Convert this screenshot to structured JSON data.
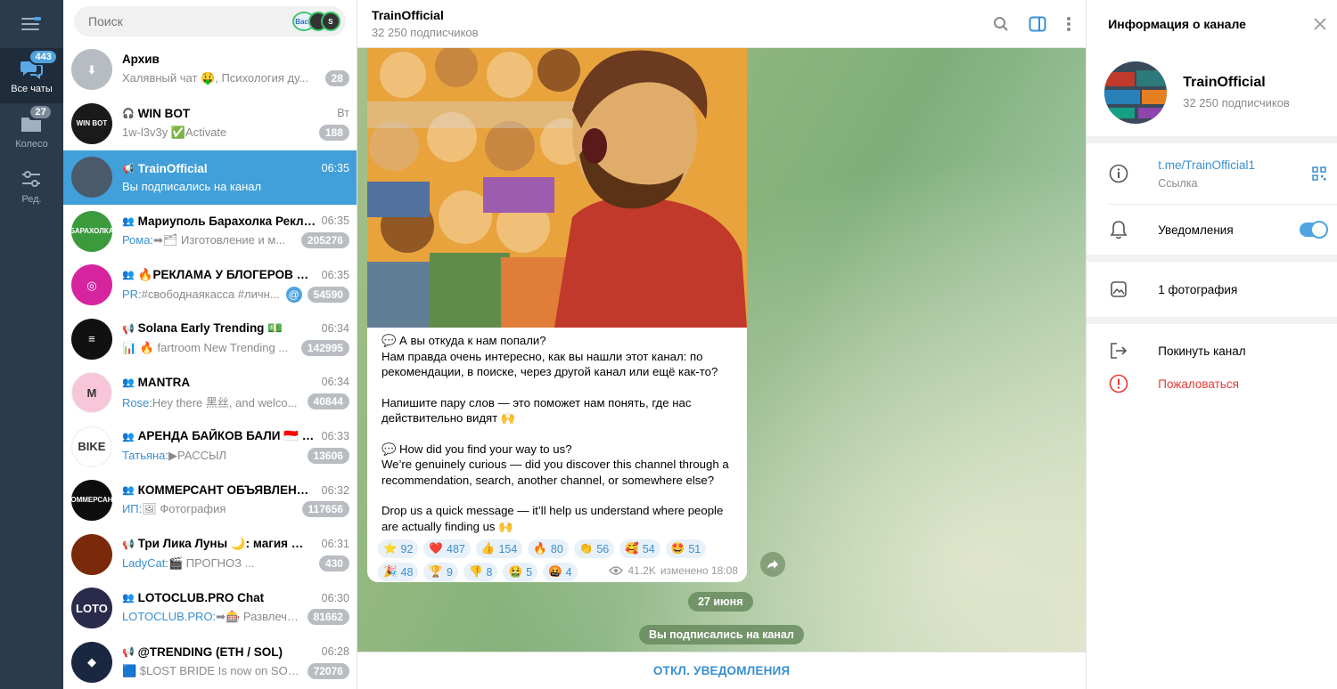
{
  "rail": {
    "folders": [
      {
        "label": "Все чаты",
        "badge": "443"
      },
      {
        "label": "Колесо",
        "badge": "27"
      },
      {
        "label": "Ред.",
        "badge": ""
      }
    ]
  },
  "search": {
    "placeholder": "Поиск",
    "story1": "Вася",
    "story2": "S"
  },
  "chats": [
    {
      "title": "Архив",
      "time": "",
      "sender": "",
      "preview": "Халявный чат 🤑, Психология ду...",
      "badge": "28",
      "avatar_text": "⬇",
      "avatar_color": "#b7bcc2"
    },
    {
      "title": "WIN BOT",
      "time": "Вт",
      "sender": "",
      "preview": "1w-l3v3y ✅Activate",
      "badge": "188",
      "avatar_text": "WIN BOT",
      "avatar_color": "#1a1a1a"
    },
    {
      "title": "TrainOfficial",
      "time": "06:35",
      "sender": "",
      "preview": "Вы подписались на канал",
      "badge": "",
      "avatar_text": "",
      "avatar_color": "#4a5a6a"
    },
    {
      "title": "Мариуполь Барахолка Рекла...",
      "time": "06:35",
      "sender": "Рома:",
      "preview": "➡🗂 Изготовление и м...",
      "badge": "205276",
      "avatar_text": "БАРАХОЛКА",
      "avatar_color": "#3b9a3b"
    },
    {
      "title": "🔥РЕКЛАМА У БЛОГЕРОВ 🔥...",
      "time": "06:35",
      "sender": "PR:",
      "preview": "#свободнаякасса #личн...",
      "badge": "54590",
      "avatar_text": "◎",
      "avatar_color": "#d6249f"
    },
    {
      "title": "Solana Early Trending 💵",
      "time": "06:34",
      "sender": "",
      "preview": "📊 🔥 fartroom New Trending ...",
      "badge": "142995",
      "avatar_text": "≡",
      "avatar_color": "#111111"
    },
    {
      "title": "MANTRA",
      "time": "06:34",
      "sender": "Rose:",
      "preview": "Hey there 黑丝, and welco...",
      "badge": "40844",
      "avatar_text": "M",
      "avatar_color": "#f7c6d9"
    },
    {
      "title": "АРЕНДА БАЙКОВ БАЛИ 🇮🇩 BI...",
      "time": "06:33",
      "sender": "Татьяна:",
      "preview": "▶РАССЫЛ",
      "badge": "13606",
      "avatar_text": "BIKE",
      "avatar_color": "#ffffff"
    },
    {
      "title": "КОММЕРСАНТ ОБЪЯВЛЕНИЯ ...",
      "time": "06:32",
      "sender": "ИП:",
      "preview": "🖼 Фотография",
      "badge": "117656",
      "avatar_text": "КОММЕРСАНТ",
      "avatar_color": "#0d0d0d"
    },
    {
      "title": "Три Лика Луны 🌙: магия 🪄...",
      "time": "06:31",
      "sender": "LadyCat:",
      "preview": "🎬 ПРОГНОЗ ...",
      "badge": "430",
      "avatar_text": "",
      "avatar_color": "#7a2a0a"
    },
    {
      "title": "LOTOCLUB.PRO Chat",
      "time": "06:30",
      "sender": "LOTOCLUB.PRO:",
      "preview": "➡🎰 Развлече...",
      "badge": "81662",
      "avatar_text": "LOTO",
      "avatar_color": "#2a2a4a"
    },
    {
      "title": "@TRENDING (ETH / SOL)",
      "time": "06:28",
      "sender": "",
      "preview": "🟦 $LOST BRIDE Is now on SOL ...",
      "badge": "72076",
      "avatar_text": "◆",
      "avatar_color": "#1a2740"
    }
  ],
  "header": {
    "title": "TrainOfficial",
    "subscribers": "32 250 подписчиков"
  },
  "message": {
    "p1_line1": "💬 А вы откуда к нам попали?",
    "p1_line2": "Нам правда очень интересно, как вы нашли этот канал: по рекомендации, в поиске, через другой канал или ещё как-то?",
    "p2": "Напишите пару слов — это поможет нам понять, где нас действительно видят 🙌",
    "p3_line1": "💬 How did you find your way to us?",
    "p3_line2": "We’re genuinely curious — did you discover this channel through a recommendation, search, another channel, or somewhere else?",
    "p4": "Drop us a quick message — it’ll help us understand where people are actually finding us 🙌",
    "views": "41.2K",
    "edited": "изменено 18:08",
    "reactions": [
      {
        "emoji": "⭐",
        "count": "92"
      },
      {
        "emoji": "❤️",
        "count": "487"
      },
      {
        "emoji": "👍",
        "count": "154"
      },
      {
        "emoji": "🔥",
        "count": "80"
      },
      {
        "emoji": "👏",
        "count": "56"
      },
      {
        "emoji": "🥰",
        "count": "54"
      },
      {
        "emoji": "🤩",
        "count": "51"
      },
      {
        "emoji": "🎉",
        "count": "48"
      },
      {
        "emoji": "🏆",
        "count": "9"
      },
      {
        "emoji": "👎",
        "count": "8"
      },
      {
        "emoji": "🤮",
        "count": "5"
      },
      {
        "emoji": "🤬",
        "count": "4"
      }
    ]
  },
  "date_pill": "27 июня",
  "service_pill": "Вы подписались на канал",
  "footer": {
    "button": "ОТКЛ. УВЕДОМЛЕНИЯ"
  },
  "info": {
    "title": "Информация о канале",
    "name": "TrainOfficial",
    "subscribers": "32 250 подписчиков",
    "link": "t.me/TrainOfficial1",
    "link_sub": "Ссылка",
    "notifications": "Уведомления",
    "notifications_on": true,
    "photos": "1 фотография",
    "leave": "Покинуть канал",
    "report": "Пожаловаться"
  },
  "colors": {
    "accent": "#419fd9",
    "rail": "#2b3a4c",
    "danger": "#e53935"
  }
}
